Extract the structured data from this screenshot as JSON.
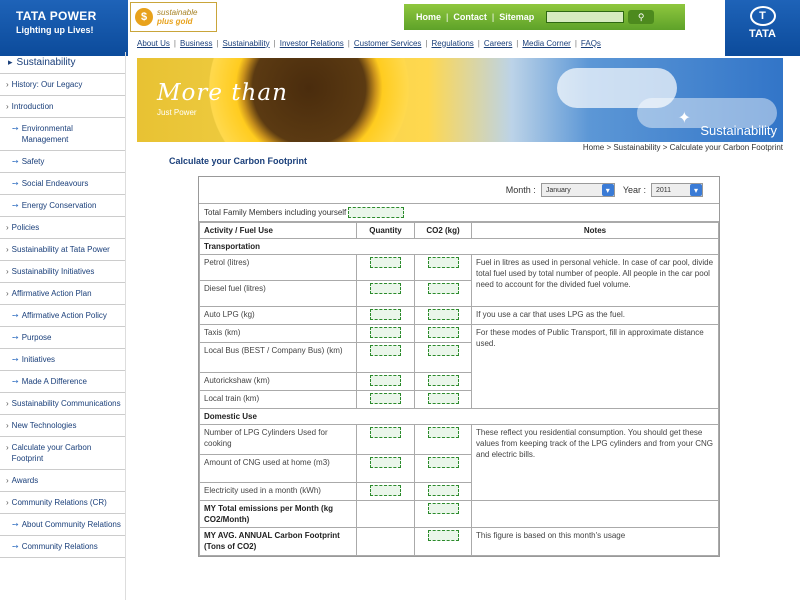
{
  "header": {
    "brand": "TATA POWER",
    "tagline": "Lighting up Lives!",
    "badge_line1": "sustainable",
    "badge_line2": "plus gold",
    "badge_icon": "$",
    "top_links": [
      "Home",
      "Contact",
      "Sitemap"
    ],
    "search_icon": "search-icon",
    "corner_brand": "TATA",
    "corner_glyph": "T"
  },
  "mainnav": [
    "About Us",
    "Business",
    "Sustainability",
    "Investor Relations",
    "Customer Services",
    "Regulations",
    "Careers",
    "Media Corner",
    "FAQs"
  ],
  "sidebar": {
    "heading": "Sustainability",
    "items": [
      {
        "label": "History: Our Legacy",
        "sub": false
      },
      {
        "label": "Introduction",
        "sub": false
      },
      {
        "label": "Environmental Management",
        "sub": true
      },
      {
        "label": "Safety",
        "sub": true
      },
      {
        "label": "Social Endeavours",
        "sub": true
      },
      {
        "label": "Energy Conservation",
        "sub": true
      },
      {
        "label": "Policies",
        "sub": false
      },
      {
        "label": "Sustainability at Tata Power",
        "sub": false
      },
      {
        "label": "Sustainability Initiatives",
        "sub": false
      },
      {
        "label": "Affirmative Action Plan",
        "sub": false
      },
      {
        "label": "Affirmative Action Policy",
        "sub": true
      },
      {
        "label": "Purpose",
        "sub": true
      },
      {
        "label": "Initiatives",
        "sub": true
      },
      {
        "label": "Made A Difference",
        "sub": true
      },
      {
        "label": "Sustainability Communications",
        "sub": false
      },
      {
        "label": "New Technologies",
        "sub": false
      },
      {
        "label": "Calculate your Carbon Footprint",
        "sub": false
      },
      {
        "label": "Awards",
        "sub": false
      },
      {
        "label": "Community Relations (CR)",
        "sub": false
      },
      {
        "label": "About Community Relations",
        "sub": true
      },
      {
        "label": "Community Relations",
        "sub": true
      }
    ]
  },
  "banner": {
    "headline": "More than",
    "subline": "Just Power",
    "label": "Sustainability"
  },
  "breadcrumb": "Home > Sustainability > Calculate your Carbon Footprint",
  "page_title": "Calculate your Carbon Footprint",
  "form": {
    "month_label": "Month :",
    "month_value": "January",
    "year_label": "Year :",
    "year_value": "2011",
    "family_label": "Total Family Members including yourself",
    "col_activity": "Activity / Fuel Use",
    "col_quantity": "Quantity",
    "col_co2": "CO2 (kg)",
    "col_notes": "Notes",
    "section_transport": "Transportation",
    "section_domestic": "Domestic Use",
    "rows_transport": [
      {
        "label": "Petrol (litres)"
      },
      {
        "label": "Diesel fuel (litres)"
      },
      {
        "label": "Auto LPG (kg)"
      },
      {
        "label": "Taxis (km)"
      },
      {
        "label": "Local Bus (BEST / Company Bus) (km)"
      },
      {
        "label": "Autorickshaw (km)"
      },
      {
        "label": "Local train (km)"
      }
    ],
    "rows_domestic": [
      {
        "label": "Number of LPG Cylinders Used for cooking"
      },
      {
        "label": "Amount of CNG used at home (m3)"
      },
      {
        "label": "Electricity used in a month (kWh)"
      }
    ],
    "notes": {
      "petrol_diesel": "Fuel in litres as used in personal vehicle. In case of car pool, divide total fuel used by total number of people. All people in the car pool need to account for the divided fuel volume.",
      "lpg": "If you use a car that uses LPG as the fuel.",
      "public": "For these modes of Public Transport, fill in approximate distance used.",
      "domestic": "These reflect you residential consumption. You should get these values from keeping track of the LPG cylinders and from your CNG and electric bills.",
      "annual": "This figure is based on this month's usage"
    },
    "total_monthly": "MY Total emissions per Month (kg CO2/Month)",
    "total_annual": "MY AVG. ANNUAL Carbon Footprint (Tons of CO2)"
  },
  "colors": {
    "brand_blue": "#0c4b9b",
    "nav_green": "#5ea229",
    "link_blue": "#1a3f7a",
    "input_green": "#2b8a2b"
  }
}
